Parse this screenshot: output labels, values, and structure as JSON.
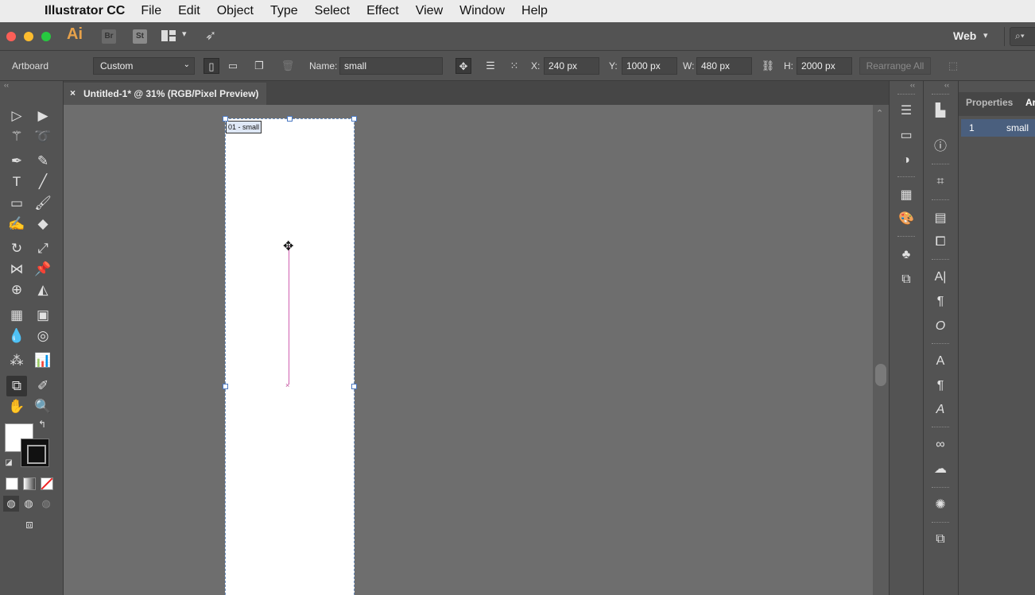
{
  "menubar": {
    "app_name": "Illustrator CC",
    "items": [
      "File",
      "Edit",
      "Object",
      "Type",
      "Select",
      "Effect",
      "View",
      "Window",
      "Help"
    ]
  },
  "appbar": {
    "logo": "Ai",
    "bridge": "Br",
    "stock": "St",
    "workspace": "Web",
    "search_glyph": "⌕▾"
  },
  "controlbar": {
    "context_label": "Artboard",
    "preset": "Custom",
    "name_label": "Name:",
    "name_value": "small",
    "x_label": "X:",
    "x_value": "240 px",
    "y_label": "Y:",
    "y_value": "1000 px",
    "w_label": "W:",
    "w_value": "480 px",
    "h_label": "H:",
    "h_value": "2000 px",
    "rearrange_label": "Rearrange All"
  },
  "document": {
    "tab_title": "Untitled-1* @ 31% (RGB/Pixel Preview)",
    "artboard_label": "01 - small"
  },
  "artboards_panel": {
    "tabs": [
      "Properties",
      "Ar"
    ],
    "rows": [
      {
        "number": "1",
        "name": "small"
      }
    ]
  },
  "colors": {
    "chrome": "#535353",
    "canvas": "#6e6e6e",
    "artboard": "#ffffff",
    "selection_blue": "#4a78c2",
    "guide_pink": "#d05fb0",
    "panel_highlight": "#4a5f7e"
  }
}
